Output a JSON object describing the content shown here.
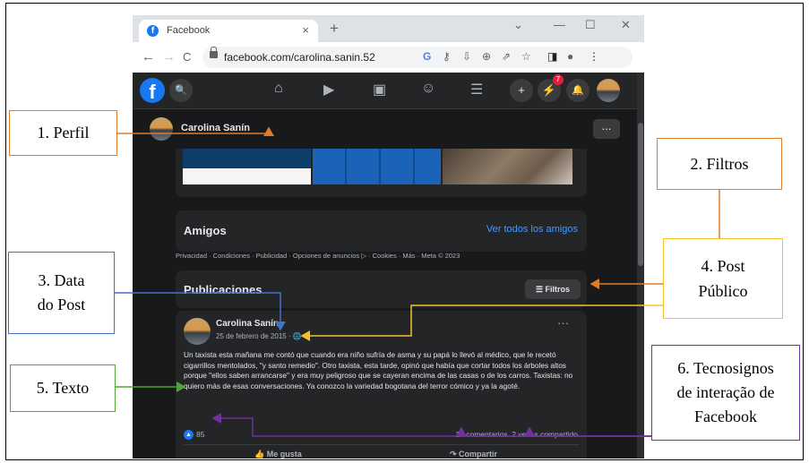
{
  "browser": {
    "tab_title": "Facebook",
    "tab_close": "×",
    "new_tab": "+",
    "win_min": "—",
    "win_max": "☐",
    "win_close": "✕",
    "win_dropdown": "⌄",
    "url": "facebook.com/carolina.sanin.52",
    "nav_back": "←",
    "nav_forward": "→",
    "nav_reload": "C",
    "omnibox_icons": [
      "G",
      "⚷",
      "⇩",
      "⊕",
      "⇗",
      "☆"
    ],
    "ext_icons": [
      "◨",
      "●",
      "⋮"
    ]
  },
  "fb_header": {
    "logo": "f",
    "search": "🔍",
    "nav_icons": [
      "⌂",
      "▶",
      "▣",
      "☺",
      "☰"
    ],
    "create": "+",
    "messenger_badge": "7",
    "messenger": "⚡",
    "notifications": "🔔"
  },
  "profile": {
    "name": "Carolina Sanín",
    "more": "..."
  },
  "amigos": {
    "heading": "Amigos",
    "link": "Ver todos los amigos"
  },
  "footer_text": "Privacidad · Condiciones · Publicidad · Opciones de anuncios ▷ · Cookies · Más · Meta © 2023",
  "publicaciones": {
    "heading": "Publicaciones",
    "filter_button": "☰ Filtros"
  },
  "post": {
    "author": "Carolina Sanín",
    "date": "25 de febrero de 2015 · 🌐",
    "more": "···",
    "text": "Un taxista esta mañana me contó que cuando era niño sufría de asma y su papá lo llevó al médico, que le recetó cigarrillos mentolados, \"y santo remedio\". Otro taxista, esta tarde, opinó que había que cortar todos los árboles altos porque \"ellos saben arrancarse\" y era muy peligroso que se cayeran encima de las casas o de los carros. Taxistas: no quiero más de esas conversaciones. Ya conozco la variedad bogotana del terror cómico y ya la agoté.",
    "likes_icon": "👍",
    "likes": "85",
    "comments": "14 comentarios",
    "shares": "2 veces compartido",
    "like_action": "👍 Me gusta",
    "share_action": "↷ Compartir"
  },
  "callouts": {
    "c1": "1.  Perfil",
    "c2": "2.  Filtros",
    "c3_line1": "3. Data",
    "c3_line2": "do Post",
    "c4_line1": "4. Post",
    "c4_line2": "Público",
    "c5": "5. Texto",
    "c6_line1": "6. Tecnosignos",
    "c6_line2": "de interação de",
    "c6_line3": "Facebook"
  },
  "colors": {
    "callout_orange": "#e07b28",
    "callout_blue": "#4472c4",
    "callout_yellow": "#f5c02a",
    "callout_green": "#4ea72e",
    "callout_purple": "#7030a0",
    "fb_blue": "#1877f2",
    "dark_bg": "#18191a"
  }
}
